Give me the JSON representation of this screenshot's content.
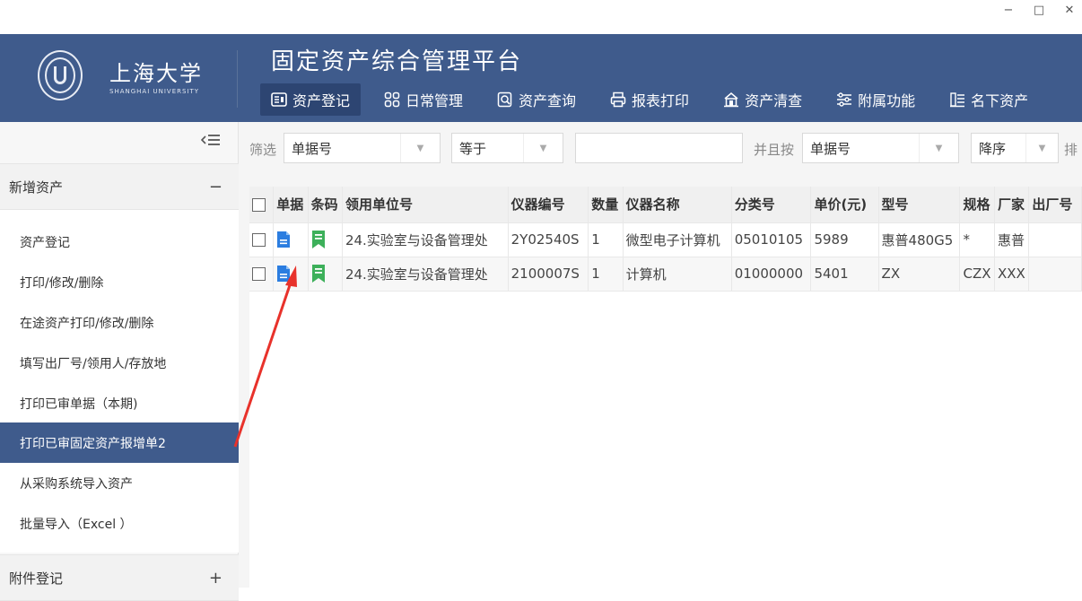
{
  "window": {
    "minimize": "−",
    "maximize": "□",
    "close": "✕"
  },
  "header": {
    "logo_cn": "上海大学",
    "logo_en": "SHANGHAI UNIVERSITY",
    "app_title": "固定资产综合管理平台",
    "nav": [
      {
        "label": "资产登记",
        "icon": "asset-register-icon",
        "active": true
      },
      {
        "label": "日常管理",
        "icon": "grid-icon"
      },
      {
        "label": "资产查询",
        "icon": "search-doc-icon"
      },
      {
        "label": "报表打印",
        "icon": "printer-icon"
      },
      {
        "label": "资产清查",
        "icon": "inventory-icon"
      },
      {
        "label": "附属功能",
        "icon": "sliders-icon"
      },
      {
        "label": "名下资产",
        "icon": "list-icon"
      }
    ]
  },
  "sidebar": {
    "collapse_icon": "collapse-menu-icon",
    "group1": {
      "label": "新增资产",
      "toggle": "−"
    },
    "items": [
      "资产登记",
      "打印/修改/删除",
      "在途资产打印/修改/删除",
      "填写出厂号/领用人/存放地",
      "打印已审单据（本期)",
      "打印已审固定资产报增单2",
      "从采购系统导入资产",
      "批量导入（Excel ）"
    ],
    "active_index": 5,
    "group2": {
      "label": "附件登记",
      "toggle": "+"
    }
  },
  "filter": {
    "label_filter": "筛选",
    "field1": "单据号",
    "operator": "等于",
    "value": "",
    "label_sort": "并且按",
    "sort_field": "单据号",
    "sort_order": "降序",
    "label_sort2": "排"
  },
  "table": {
    "columns": [
      "单据",
      "条码",
      "领用单位号",
      "仪器编号",
      "数量",
      "仪器名称",
      "分类号",
      "单价(元)",
      "型号",
      "规格",
      "厂家",
      "出厂号"
    ],
    "rows": [
      [
        "24.实验室与设备管理处",
        "2Y02540S",
        "1",
        "微型电子计算机",
        "05010105",
        "5989",
        "惠普480G5",
        "*",
        "惠普",
        ""
      ],
      [
        "24.实验室与设备管理处",
        "2100007S",
        "1",
        "计算机",
        "01000000",
        "5401",
        "ZX",
        "CZX",
        "XXX",
        ""
      ]
    ]
  },
  "colors": {
    "header_bg": "#3f5b8c",
    "doc_icon": "#2b7de0",
    "barcode_icon": "#3db05a",
    "annotation_arrow": "#e8322b"
  }
}
